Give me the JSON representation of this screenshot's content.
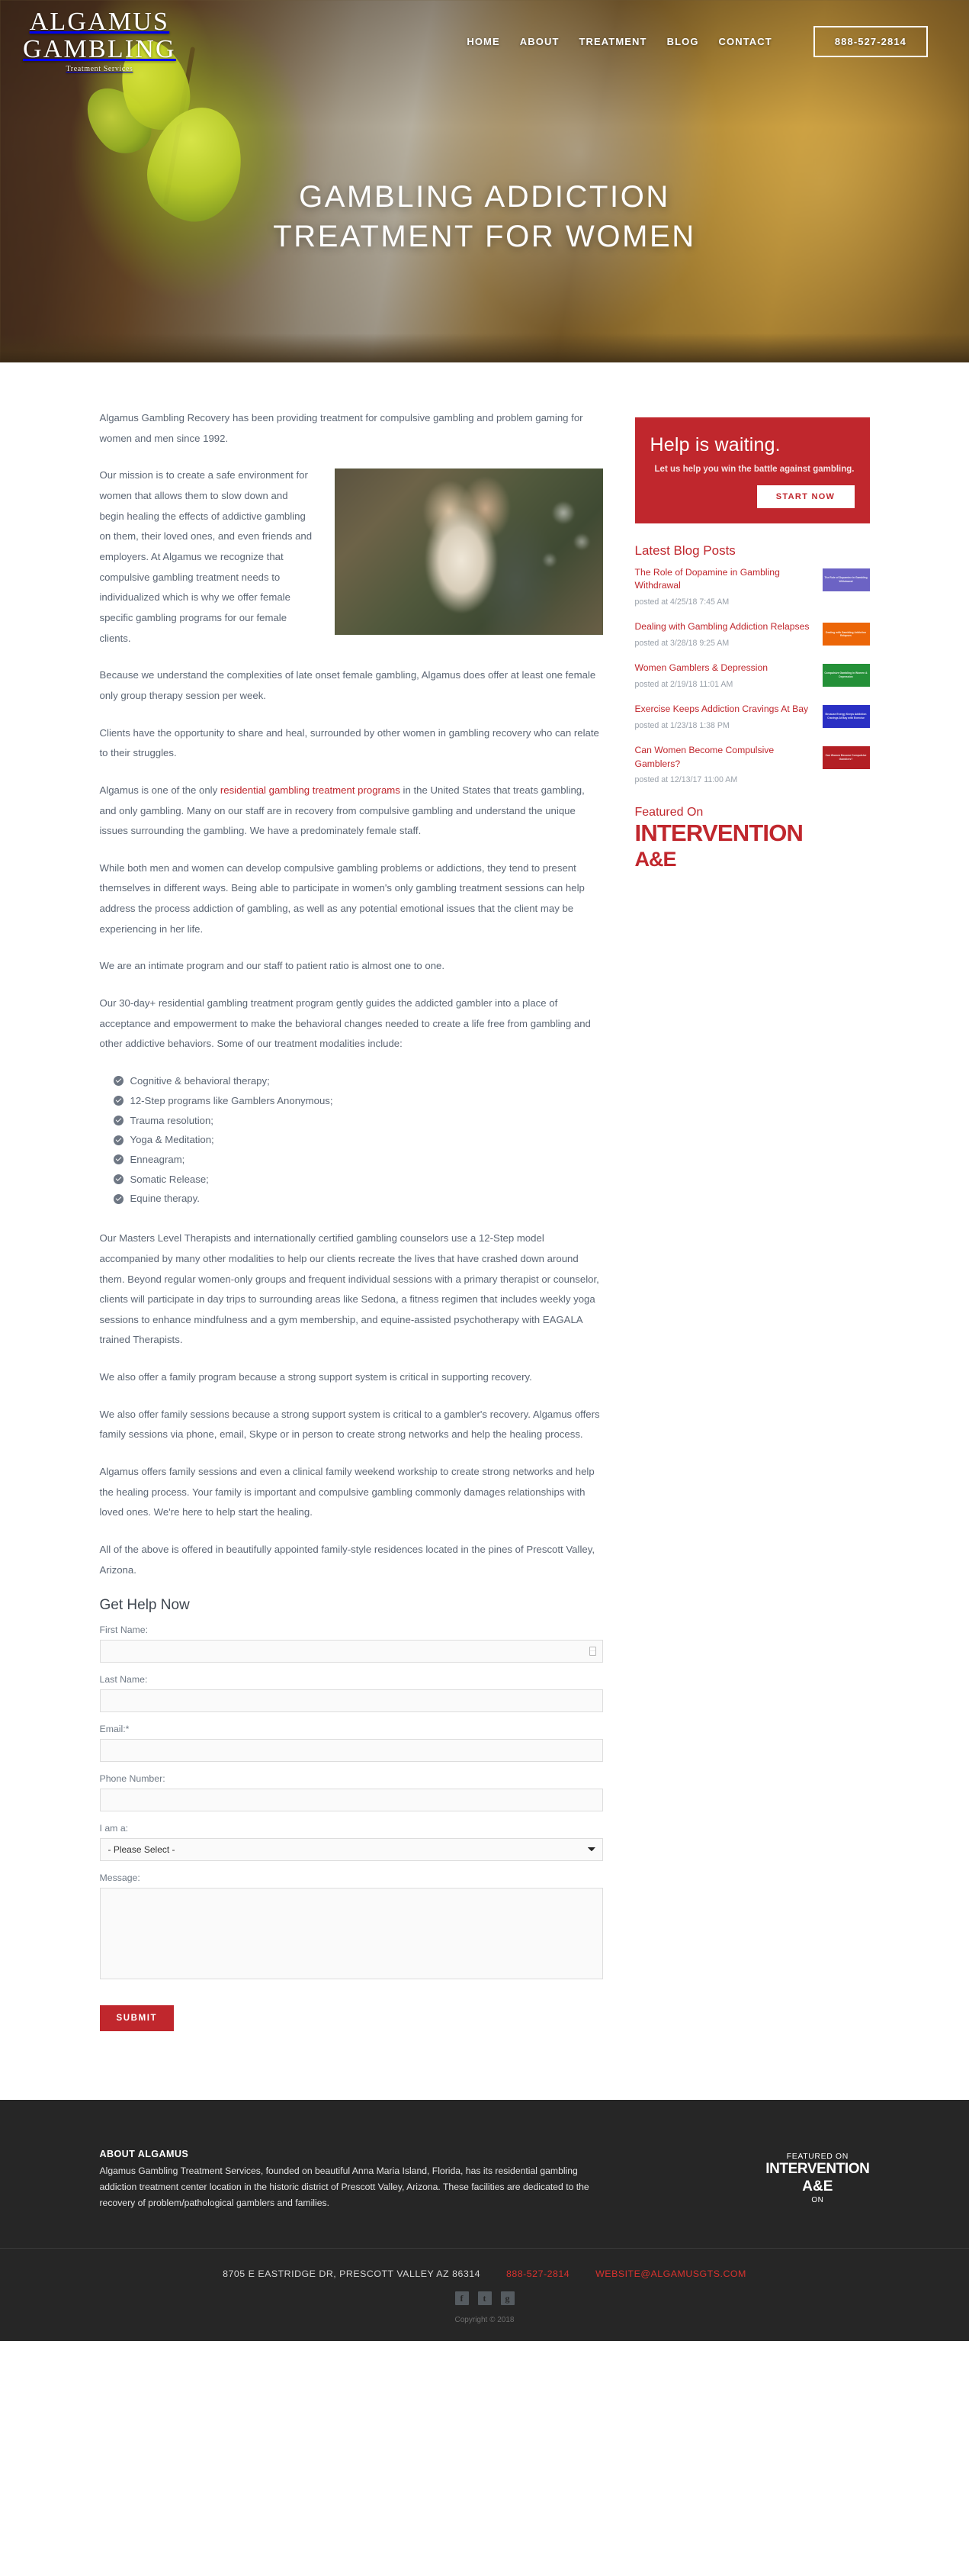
{
  "header": {
    "logo_line1": "ALGAMUS",
    "logo_line2": "GAMBLING",
    "logo_tagline": "Treatment Services",
    "nav": [
      {
        "label": "HOME"
      },
      {
        "label": "ABOUT"
      },
      {
        "label": "TREATMENT"
      },
      {
        "label": "BLOG"
      },
      {
        "label": "CONTACT"
      }
    ],
    "phone_button": "888-527-2814"
  },
  "hero": {
    "title_line1": "GAMBLING ADDICTION",
    "title_line2": "TREATMENT FOR WOMEN"
  },
  "main": {
    "paragraphs": [
      "Algamus Gambling Recovery has been providing treatment for compulsive gambling and problem gaming for women and men since 1992.",
      "Our mission is to create a safe environment for women that allows them to slow down and begin healing the effects of addictive gambling on them, their loved ones, and even friends and employers. At Algamus we recognize that compulsive gambling treatment needs to individualized which is why we offer female specific gambling programs for our female clients.",
      "Because we understand the complexities of late onset female gambling, Algamus does offer at least one female only group therapy session per week.",
      "Clients have the opportunity to share and heal, surrounded by other women in gambling recovery who can relate to their struggles."
    ],
    "link_paragraph": {
      "before": "Algamus is one of the only ",
      "link": "residential gambling treatment programs",
      "after": " in the United States that treats gambling, and only gambling. Many on our staff are in recovery from compulsive gambling and understand the unique issues surrounding the gambling. We have a predominately female staff."
    },
    "paragraphs2": [
      "While both men and women can develop compulsive gambling problems or addictions, they tend to present themselves in different ways. Being able to participate in women's only gambling treatment sessions can help address the process addiction of gambling, as well as any potential emotional issues that the client may be experiencing in her life.",
      "We are an intimate program and our staff to patient ratio is almost one to one.",
      "Our 30-day+ residential gambling treatment program gently guides the addicted gambler into a place of acceptance and empowerment to make the behavioral changes needed to create a life free from gambling and other addictive behaviors. Some of our treatment modalities include:"
    ],
    "bullets": [
      "Cognitive & behavioral therapy;",
      "12-Step programs like Gamblers Anonymous;",
      "Trauma resolution;",
      "Yoga & Meditation;",
      "Enneagram;",
      "Somatic Release;",
      "Equine therapy."
    ],
    "paragraphs3": [
      "Our Masters Level Therapists and internationally certified gambling counselors use a 12-Step model accompanied by many other modalities to help our clients recreate the lives that have crashed down around them. Beyond regular women-only groups and frequent individual sessions with a primary therapist or counselor, clients will participate in day trips to surrounding areas like Sedona, a fitness regimen that includes weekly yoga sessions to enhance mindfulness and a gym membership, and equine-assisted psychotherapy with EAGALA trained Therapists.",
      "We also offer a family program because a strong support system is critical in supporting recovery.",
      "We also offer family sessions because a strong support system is critical to a gambler's recovery. Algamus offers family sessions via phone, email, Skype or in person to create strong networks and help the healing process.",
      "Algamus offers family sessions and even a clinical family weekend workship to create strong networks and help the healing process. Your family is important and compulsive gambling commonly damages relationships with loved ones. We're here to help start the healing.",
      "All of the above is offered in beautifully appointed family-style residences located in the pines of Prescott Valley, Arizona."
    ]
  },
  "sidebar": {
    "banner": {
      "heading": "Help is waiting.",
      "subtext": "Let us help you win the battle against gambling.",
      "cta": "START NOW",
      "color": "#c0272d"
    },
    "blog_heading": "Latest Blog Posts",
    "posts": [
      {
        "title": "The Role of Dopamine in Gambling Withdrawal",
        "date": "posted at 4/25/18 7:45 AM",
        "thumb_color": "#6c63c4",
        "thumb_text": "The Role of Dopamine in Gambling Withdrawal"
      },
      {
        "title": "Dealing with Gambling Addiction Relapses",
        "date": "posted at 3/28/18 9:25 AM",
        "thumb_color": "#ec6608",
        "thumb_text": "Dealing with Gambling Addiction Relapses"
      },
      {
        "title": "Women Gamblers & Depression",
        "date": "posted at 2/19/18 11:01 AM",
        "thumb_color": "#249038",
        "thumb_text": "Compulsive Gambling in Women & Depression"
      },
      {
        "title": "Exercise Keeps Addiction Cravings At Bay",
        "date": "posted at 1/23/18 1:38 PM",
        "thumb_color": "#2a30c4",
        "thumb_text": "Because Energy Keeps Addiction Cravings At Bay with Exercise"
      },
      {
        "title": "Can Women Become Compulsive Gamblers?",
        "date": "posted at 12/13/17 11:00 AM",
        "thumb_color": "#b31f24",
        "thumb_text": "Can Women Become Compulsive Gamblers?"
      }
    ],
    "featured_label": "Featured On",
    "featured_show": "INTERVENTION",
    "featured_network": "A&E"
  },
  "form": {
    "heading": "Get Help Now",
    "fields": [
      {
        "label": "First Name:",
        "value": "",
        "type": "text",
        "icon": "contact-card-icon"
      },
      {
        "label": "Last Name:",
        "value": "",
        "type": "text"
      },
      {
        "label": "Email:*",
        "value": "",
        "type": "text"
      },
      {
        "label": "Phone Number:",
        "value": "",
        "type": "text"
      }
    ],
    "select": {
      "label": "I am a:",
      "value": "- Please Select -",
      "options": [
        "- Please Select -"
      ]
    },
    "message": {
      "label": "Message:",
      "value": ""
    },
    "submit": "SUBMIT"
  },
  "footer": {
    "about_heading": "ABOUT ALGAMUS",
    "about_text": "Algamus Gambling Treatment Services, founded on beautiful Anna Maria Island, Florida, has its residential gambling addiction treatment center location in the historic district of Prescott Valley, Arizona. These facilities are dedicated to the recovery of problem/pathological gamblers and families.",
    "featured_label": "FEATURED ON",
    "featured_show": "INTERVENTION",
    "featured_network": "A&E",
    "featured_on_word": "ON",
    "address": "8705 E EASTRIDGE DR, PRESCOTT VALLEY AZ 86314",
    "phone": "888-527-2814",
    "email": "WEBSITE@ALGAMUSGTS.COM",
    "social": [
      {
        "name": "facebook-icon",
        "glyph": "f"
      },
      {
        "name": "twitter-icon",
        "glyph": "t"
      },
      {
        "name": "google-plus-icon",
        "glyph": "g"
      }
    ],
    "copyright": "Copyright © 2018"
  }
}
